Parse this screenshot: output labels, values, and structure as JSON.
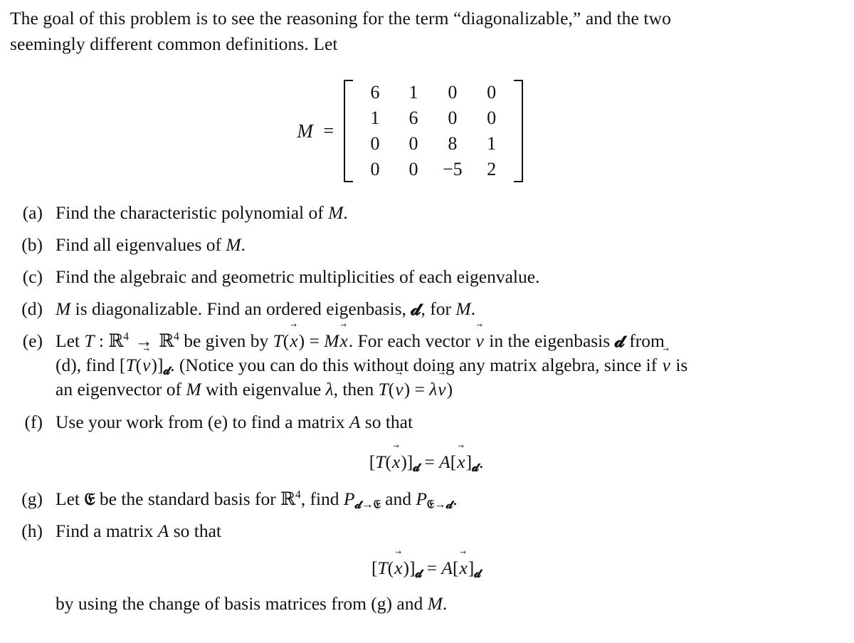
{
  "document": {
    "intro": {
      "line1": "The goal of this problem is to see the reasoning for the term “diagonalizable,” and the two",
      "line2": "seemingly different common definitions. Let"
    },
    "matrix_display": {
      "lhs": "M",
      "equals": "=",
      "matrix": {
        "rows": [
          [
            "6",
            "1",
            "0",
            "0"
          ],
          [
            "1",
            "6",
            "0",
            "0"
          ],
          [
            "0",
            "0",
            "8",
            "1"
          ],
          [
            "0",
            "0",
            "−5",
            "2"
          ]
        ]
      }
    },
    "items": [
      {
        "marker": "(a)",
        "lines": [
          "Find the characteristic polynomial of M ."
        ]
      },
      {
        "marker": "(b)",
        "lines": [
          "Find all eigenvalues of M ."
        ]
      },
      {
        "marker": "(c)",
        "lines": [
          "Find the algebraic and geometric multiplicities of each eigenvalue."
        ]
      },
      {
        "marker": "(d)",
        "lines": [
          "M is diagonalizable. Find an ordered eigenbasis, ℬ, for M ."
        ]
      },
      {
        "marker": "(e)",
        "lines": [
          "Let T : ℝ⁴ → ℝ⁴ be given by T(x⃗) = Mx⃗. For each vector v⃗ in the eigenbasis ℬ from",
          "(d), find [T(v⃗)]ℬ. (Notice you can do this without doing any matrix algebra, since if v⃗ is",
          "an eigenvector of M with eigenvalue λ, then T(v⃗) = λv⃗)"
        ]
      },
      {
        "marker": "(f)",
        "lines": [
          "Use your work from (e) to find a matrix A so that"
        ],
        "equation": "[T(x⃗)]ℬ = A[x⃗]ℬ."
      },
      {
        "marker": "(g)",
        "lines": [
          "Let ℬ be the standard basis for ℝ⁴, find Pℬ→ℰ and Pℰ→ℬ."
        ]
      },
      {
        "marker": "(h)",
        "lines": [
          "Find a matrix A so that"
        ],
        "equation": "[T(x⃗)]ℬ = A[x⃗]ℬ",
        "after": "by using the change of basis matrices from (g) and M ."
      }
    ],
    "symbols": {
      "basis_b": "ℬ",
      "basis_e": "ℰ",
      "reals": "ℝ",
      "lambda": "λ",
      "to_arrow": "→",
      "matrix_name": "M",
      "transform_name": "T",
      "answer_matrix_name": "A",
      "vector_x": "x",
      "vector_v": "v",
      "dimension": "4",
      "change_of_basis_symbol": "P"
    },
    "colors": {
      "background": "#ffffff",
      "text": "#111111"
    }
  }
}
